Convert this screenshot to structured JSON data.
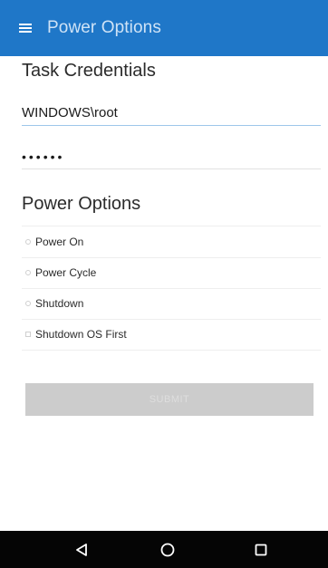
{
  "app_bar": {
    "title": "Power Options",
    "menu_icon": "hamburger-menu-icon",
    "background": "#1f77c8"
  },
  "credentials": {
    "heading": "Task Credentials",
    "username": "WINDOWS\\root",
    "password": "••••••"
  },
  "power": {
    "heading": "Power Options",
    "options": [
      {
        "label": "Power On",
        "type": "radio",
        "selected": false
      },
      {
        "label": "Power Cycle",
        "type": "radio",
        "selected": false
      },
      {
        "label": "Shutdown",
        "type": "radio",
        "selected": false
      },
      {
        "label": "Shutdown OS First",
        "type": "checkbox",
        "checked": false
      }
    ]
  },
  "submit": {
    "label": "SUBMIT",
    "enabled": false
  },
  "nav": {
    "back_icon": "back-triangle-icon",
    "home_icon": "home-circle-icon",
    "recents_icon": "recents-square-icon"
  }
}
